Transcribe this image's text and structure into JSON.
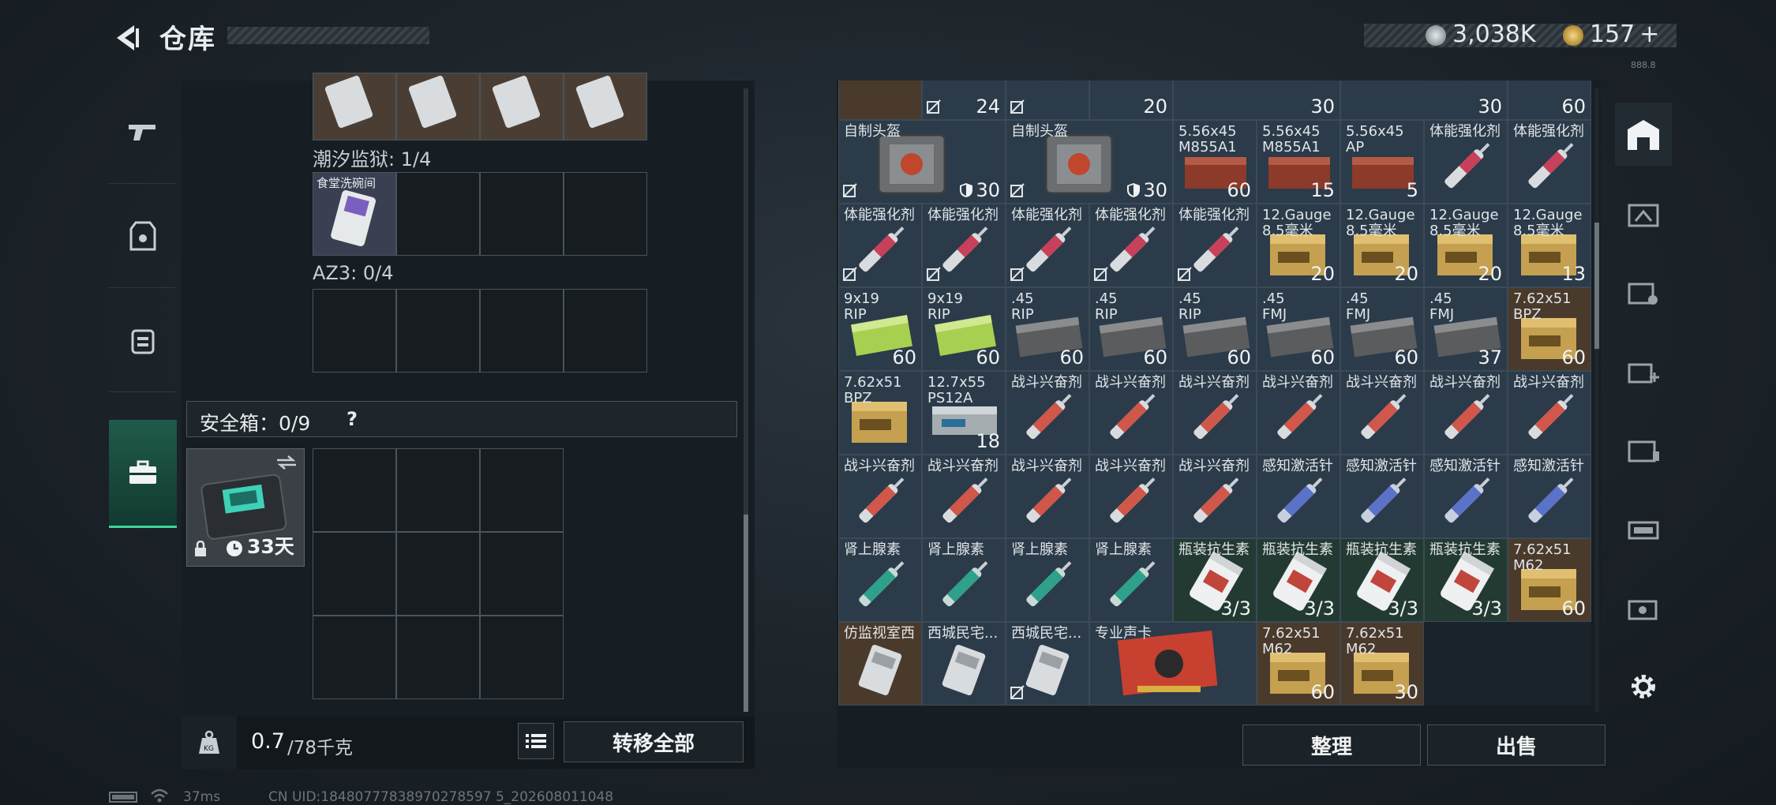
{
  "header": {
    "title": "仓库",
    "currency1": "3,038K",
    "currency2": "157",
    "plus": "+",
    "tiny": "888.8"
  },
  "left": {
    "sec1_label": "潮汐监狱: 1/4",
    "sec1_item": "食堂洗碗间",
    "sec2_label": "AZ3: 0/4",
    "safebox_label": "安全箱：0/9",
    "safebox_help": "?",
    "safebox_days": "33天",
    "weight_value": "0.7",
    "weight_max": "/78千克",
    "transfer_all": "转移全部",
    "kg_label": "KG"
  },
  "right": {
    "row0_counts": [
      "24",
      "20",
      "30",
      "30",
      "60"
    ],
    "sort_button": "整理",
    "sell_button": "出售"
  },
  "grid": [
    {
      "c": 0,
      "r": 1,
      "bg": "blue",
      "name": "自制头盔",
      "count": "30",
      "type": "helmet",
      "nodrop": true,
      "shield": true
    },
    {
      "c": 2,
      "r": 1,
      "bg": "blue",
      "name": "自制头盔",
      "count": "30",
      "type": "helmet",
      "nodrop": true,
      "shield": true
    },
    {
      "c": 4,
      "r": 1,
      "bg": "blue",
      "name": "5.56x45\nM855A1",
      "count": "60",
      "type": "ammo-red"
    },
    {
      "c": 5,
      "r": 1,
      "bg": "blue",
      "name": "5.56x45\nM855A1",
      "count": "15",
      "type": "ammo-red"
    },
    {
      "c": 6,
      "r": 1,
      "bg": "blue",
      "name": "5.56x45\nAP",
      "count": "5",
      "type": "ammo-red"
    },
    {
      "c": 7,
      "r": 1,
      "bg": "blue",
      "name": "体能强化剂",
      "count": "",
      "type": "syringe-red"
    },
    {
      "c": 8,
      "r": 1,
      "bg": "blue",
      "name": "体能强化剂",
      "count": "",
      "type": "syringe-red"
    },
    {
      "c": 0,
      "r": 2,
      "bg": "blue",
      "name": "体能强化剂",
      "count": "",
      "type": "syringe-red",
      "nodrop": true
    },
    {
      "c": 1,
      "r": 2,
      "bg": "blue",
      "name": "体能强化剂",
      "count": "",
      "type": "syringe-red",
      "nodrop": true
    },
    {
      "c": 2,
      "r": 2,
      "bg": "blue",
      "name": "体能强化剂",
      "count": "",
      "type": "syringe-red",
      "nodrop": true
    },
    {
      "c": 3,
      "r": 2,
      "bg": "blue",
      "name": "体能强化剂",
      "count": "",
      "type": "syringe-red",
      "nodrop": true
    },
    {
      "c": 4,
      "r": 2,
      "bg": "blue",
      "name": "体能强化剂",
      "count": "",
      "type": "syringe-red",
      "nodrop": true
    },
    {
      "c": 5,
      "r": 2,
      "bg": "blue",
      "name": "12.Gauge\n8.5毫米",
      "count": "20",
      "type": "box-gold"
    },
    {
      "c": 6,
      "r": 2,
      "bg": "blue",
      "name": "12.Gauge\n8.5毫米",
      "count": "20",
      "type": "box-gold"
    },
    {
      "c": 7,
      "r": 2,
      "bg": "blue",
      "name": "12.Gauge\n8.5毫米",
      "count": "20",
      "type": "box-gold"
    },
    {
      "c": 8,
      "r": 2,
      "bg": "blue",
      "name": "12.Gauge\n8.5毫米",
      "count": "13",
      "type": "box-gold"
    },
    {
      "c": 0,
      "r": 3,
      "bg": "blue",
      "name": "9x19\nRIP",
      "count": "60",
      "type": "box-green"
    },
    {
      "c": 1,
      "r": 3,
      "bg": "blue",
      "name": "9x19\nRIP",
      "count": "60",
      "type": "box-green"
    },
    {
      "c": 2,
      "r": 3,
      "bg": "blue",
      "name": ".45\nRIP",
      "count": "60",
      "type": "box-grey"
    },
    {
      "c": 3,
      "r": 3,
      "bg": "blue",
      "name": ".45\nRIP",
      "count": "60",
      "type": "box-grey"
    },
    {
      "c": 4,
      "r": 3,
      "bg": "blue",
      "name": ".45\nRIP",
      "count": "60",
      "type": "box-grey"
    },
    {
      "c": 5,
      "r": 3,
      "bg": "blue",
      "name": ".45\nFMJ",
      "count": "60",
      "type": "box-grey"
    },
    {
      "c": 6,
      "r": 3,
      "bg": "blue",
      "name": ".45\nFMJ",
      "count": "60",
      "type": "box-grey"
    },
    {
      "c": 7,
      "r": 3,
      "bg": "blue",
      "name": ".45\nFMJ",
      "count": "37",
      "type": "box-grey"
    },
    {
      "c": 8,
      "r": 3,
      "bg": "brown",
      "name": "7.62x51\nBPZ",
      "count": "60",
      "type": "box-gold"
    },
    {
      "c": 0,
      "r": 4,
      "bg": "blue",
      "name": "7.62x51\nBPZ",
      "count": "",
      "type": "box-gold"
    },
    {
      "c": 1,
      "r": 4,
      "bg": "blue",
      "name": "12.7x55\nPS12A",
      "count": "18",
      "type": "box-silver"
    },
    {
      "c": 2,
      "r": 4,
      "bg": "blue",
      "name": "战斗兴奋剂",
      "count": "",
      "type": "syringe-orange"
    },
    {
      "c": 3,
      "r": 4,
      "bg": "blue",
      "name": "战斗兴奋剂",
      "count": "",
      "type": "syringe-orange"
    },
    {
      "c": 4,
      "r": 4,
      "bg": "blue",
      "name": "战斗兴奋剂",
      "count": "",
      "type": "syringe-orange"
    },
    {
      "c": 5,
      "r": 4,
      "bg": "blue",
      "name": "战斗兴奋剂",
      "count": "",
      "type": "syringe-orange"
    },
    {
      "c": 6,
      "r": 4,
      "bg": "blue",
      "name": "战斗兴奋剂",
      "count": "",
      "type": "syringe-orange"
    },
    {
      "c": 7,
      "r": 4,
      "bg": "blue",
      "name": "战斗兴奋剂",
      "count": "",
      "type": "syringe-orange"
    },
    {
      "c": 8,
      "r": 4,
      "bg": "blue",
      "name": "战斗兴奋剂",
      "count": "",
      "type": "syringe-orange"
    },
    {
      "c": 0,
      "r": 5,
      "bg": "blue",
      "name": "战斗兴奋剂",
      "count": "",
      "type": "syringe-orange"
    },
    {
      "c": 1,
      "r": 5,
      "bg": "blue",
      "name": "战斗兴奋剂",
      "count": "",
      "type": "syringe-orange"
    },
    {
      "c": 2,
      "r": 5,
      "bg": "blue",
      "name": "战斗兴奋剂",
      "count": "",
      "type": "syringe-orange"
    },
    {
      "c": 3,
      "r": 5,
      "bg": "blue",
      "name": "战斗兴奋剂",
      "count": "",
      "type": "syringe-orange"
    },
    {
      "c": 4,
      "r": 5,
      "bg": "blue",
      "name": "战斗兴奋剂",
      "count": "",
      "type": "syringe-orange"
    },
    {
      "c": 5,
      "r": 5,
      "bg": "blue",
      "name": "感知激活针",
      "count": "",
      "type": "syringe-blue"
    },
    {
      "c": 6,
      "r": 5,
      "bg": "blue",
      "name": "感知激活针",
      "count": "",
      "type": "syringe-blue"
    },
    {
      "c": 7,
      "r": 5,
      "bg": "blue",
      "name": "感知激活针",
      "count": "",
      "type": "syringe-blue"
    },
    {
      "c": 8,
      "r": 5,
      "bg": "blue",
      "name": "感知激活针",
      "count": "",
      "type": "syringe-blue"
    },
    {
      "c": 0,
      "r": 6,
      "bg": "blue",
      "name": "肾上腺素",
      "count": "",
      "type": "syringe-teal"
    },
    {
      "c": 1,
      "r": 6,
      "bg": "blue",
      "name": "肾上腺素",
      "count": "",
      "type": "syringe-teal"
    },
    {
      "c": 2,
      "r": 6,
      "bg": "blue",
      "name": "肾上腺素",
      "count": "",
      "type": "syringe-teal"
    },
    {
      "c": 3,
      "r": 6,
      "bg": "blue",
      "name": "肾上腺素",
      "count": "",
      "type": "syringe-teal"
    },
    {
      "c": 4,
      "r": 6,
      "bg": "green",
      "name": "瓶装抗生素",
      "count": "3/3",
      "type": "pills"
    },
    {
      "c": 5,
      "r": 6,
      "bg": "green",
      "name": "瓶装抗生素",
      "count": "3/3",
      "type": "pills"
    },
    {
      "c": 6,
      "r": 6,
      "bg": "green",
      "name": "瓶装抗生素",
      "count": "3/3",
      "type": "pills"
    },
    {
      "c": 7,
      "r": 6,
      "bg": "green",
      "name": "瓶装抗生素",
      "count": "3/3",
      "type": "pills"
    },
    {
      "c": 8,
      "r": 6,
      "bg": "brown",
      "name": "7.62x51\nM62",
      "count": "60",
      "type": "box-gold"
    },
    {
      "c": 0,
      "r": 7,
      "bg": "brown",
      "name": "仿监视室西",
      "count": "",
      "type": "card"
    },
    {
      "c": 1,
      "r": 7,
      "bg": "blue",
      "name": "西城民宅...",
      "count": "",
      "type": "card"
    },
    {
      "c": 2,
      "r": 7,
      "bg": "blue",
      "name": "西城民宅...",
      "count": "",
      "type": "card",
      "nodrop": true
    },
    {
      "c": 3,
      "r": 7,
      "bg": "blue",
      "name": "专业声卡",
      "count": "",
      "type": "gpu",
      "wide": true
    },
    {
      "c": 5,
      "r": 7,
      "bg": "brown",
      "name": "7.62x51\nM62",
      "count": "60",
      "type": "box-gold"
    },
    {
      "c": 6,
      "r": 7,
      "bg": "brown",
      "name": "7.62x51\nM62",
      "count": "30",
      "type": "box-gold"
    }
  ],
  "status": {
    "ping": "37ms",
    "uid": "CN UID:18480777838970278597 5_202608011048"
  }
}
